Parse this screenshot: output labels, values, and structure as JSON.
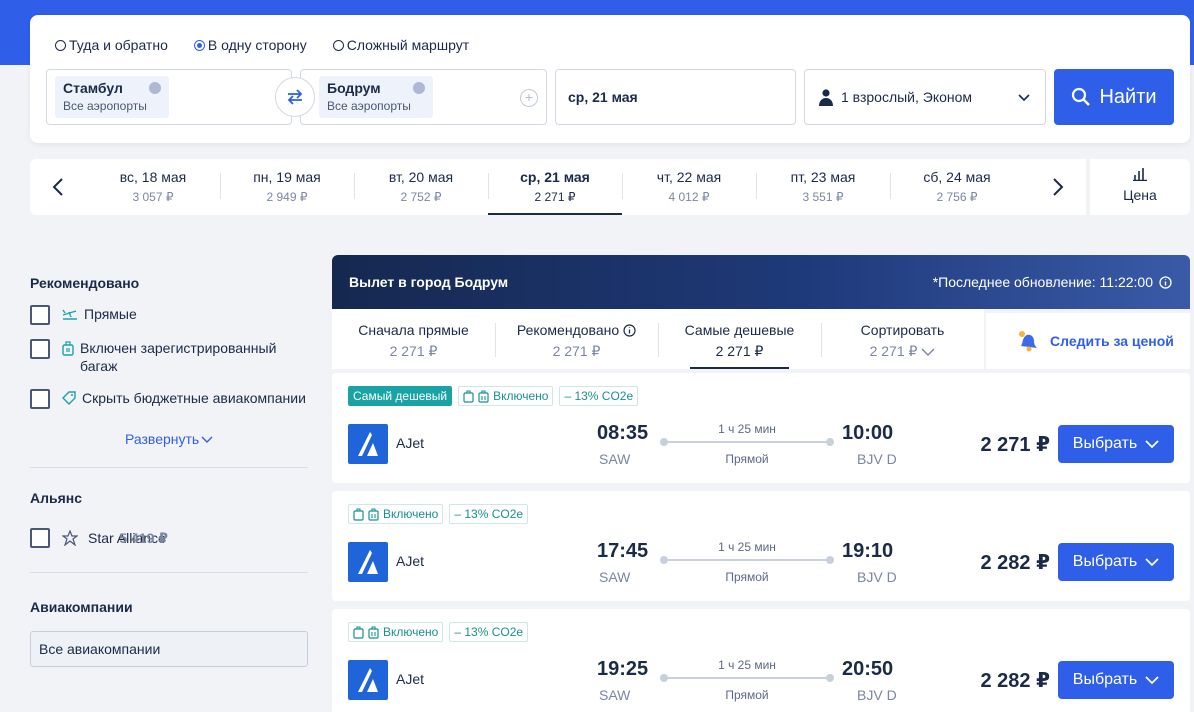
{
  "search": {
    "trip_types": [
      {
        "label": "Туда и обратно",
        "checked": false
      },
      {
        "label": "В одну сторону",
        "checked": true
      },
      {
        "label": "Сложный маршрут",
        "checked": false
      }
    ],
    "from": {
      "city": "Стамбул",
      "airports": "Все аэропорты"
    },
    "to": {
      "city": "Бодрум",
      "airports": "Все аэропорты"
    },
    "date": "ср, 21 мая",
    "passengers": "1 взрослый, Эконом",
    "find_label": "Найти"
  },
  "date_strip": {
    "days": [
      {
        "date": "вс, 18 мая",
        "price": "3 057 ₽"
      },
      {
        "date": "пн, 19 мая",
        "price": "2 949 ₽"
      },
      {
        "date": "вт, 20 мая",
        "price": "2 752 ₽"
      },
      {
        "date": "ср, 21 мая",
        "price": "2 271 ₽"
      },
      {
        "date": "чт, 22 мая",
        "price": "4 012 ₽"
      },
      {
        "date": "пт, 23 мая",
        "price": "3 551 ₽"
      },
      {
        "date": "сб, 24 мая",
        "price": "2 756 ₽"
      }
    ],
    "active_index": 3,
    "price_toggle_label": "Цена"
  },
  "sidebar": {
    "recommended_title": "Рекомендовано",
    "recommended_items": [
      {
        "label": "Прямые"
      },
      {
        "label": "Включен зарегистрированный багаж"
      },
      {
        "label": "Скрыть бюджетные авиакомпании"
      }
    ],
    "expand_label": "Развернуть",
    "alliance_title": "Альянс",
    "alliance_item": {
      "label": "Star Alliance",
      "price": "5 419 ₽"
    },
    "airlines_title": "Авиакомпании",
    "airlines_select": "Все авиакомпании"
  },
  "results": {
    "title": "Вылет в город Бодрум",
    "last_update": "*Последнее обновление: 11:22:00",
    "sort_tabs": [
      {
        "label": "Сначала прямые",
        "value": "2 271 ₽"
      },
      {
        "label": "Рекомендовано",
        "value": "2 271 ₽"
      },
      {
        "label": "Самые дешевые",
        "value": "2 271 ₽"
      },
      {
        "label": "Сортировать",
        "value": "2 271 ₽"
      }
    ],
    "active_sort": 2,
    "watch_label": "Следить за ценой",
    "flights": [
      {
        "cheapest_badge": "Самый дешевый",
        "baggage": "Включено",
        "co2": "– 13% CO2e",
        "airline": "AJet",
        "dep_time": "08:35",
        "dep_code": "SAW",
        "duration": "1 ч 25 мин",
        "type": "Прямой",
        "arr_time": "10:00",
        "arr_code": "BJV D",
        "price": "2 271 ₽",
        "select_label": "Выбрать"
      },
      {
        "cheapest_badge": "",
        "baggage": "Включено",
        "co2": "– 13% CO2e",
        "airline": "AJet",
        "dep_time": "17:45",
        "dep_code": "SAW",
        "duration": "1 ч 25 мин",
        "type": "Прямой",
        "arr_time": "19:10",
        "arr_code": "BJV D",
        "price": "2 282 ₽",
        "select_label": "Выбрать"
      },
      {
        "cheapest_badge": "",
        "baggage": "Включено",
        "co2": "– 13% CO2e",
        "airline": "AJet",
        "dep_time": "19:25",
        "dep_code": "SAW",
        "duration": "1 ч 25 мин",
        "type": "Прямой",
        "arr_time": "20:50",
        "arr_code": "BJV D",
        "price": "2 282 ₽",
        "select_label": "Выбрать"
      }
    ]
  },
  "colors": {
    "accent": "#2f5fe8",
    "dark": "#1b2a47",
    "teal": "#1aa3a5"
  }
}
